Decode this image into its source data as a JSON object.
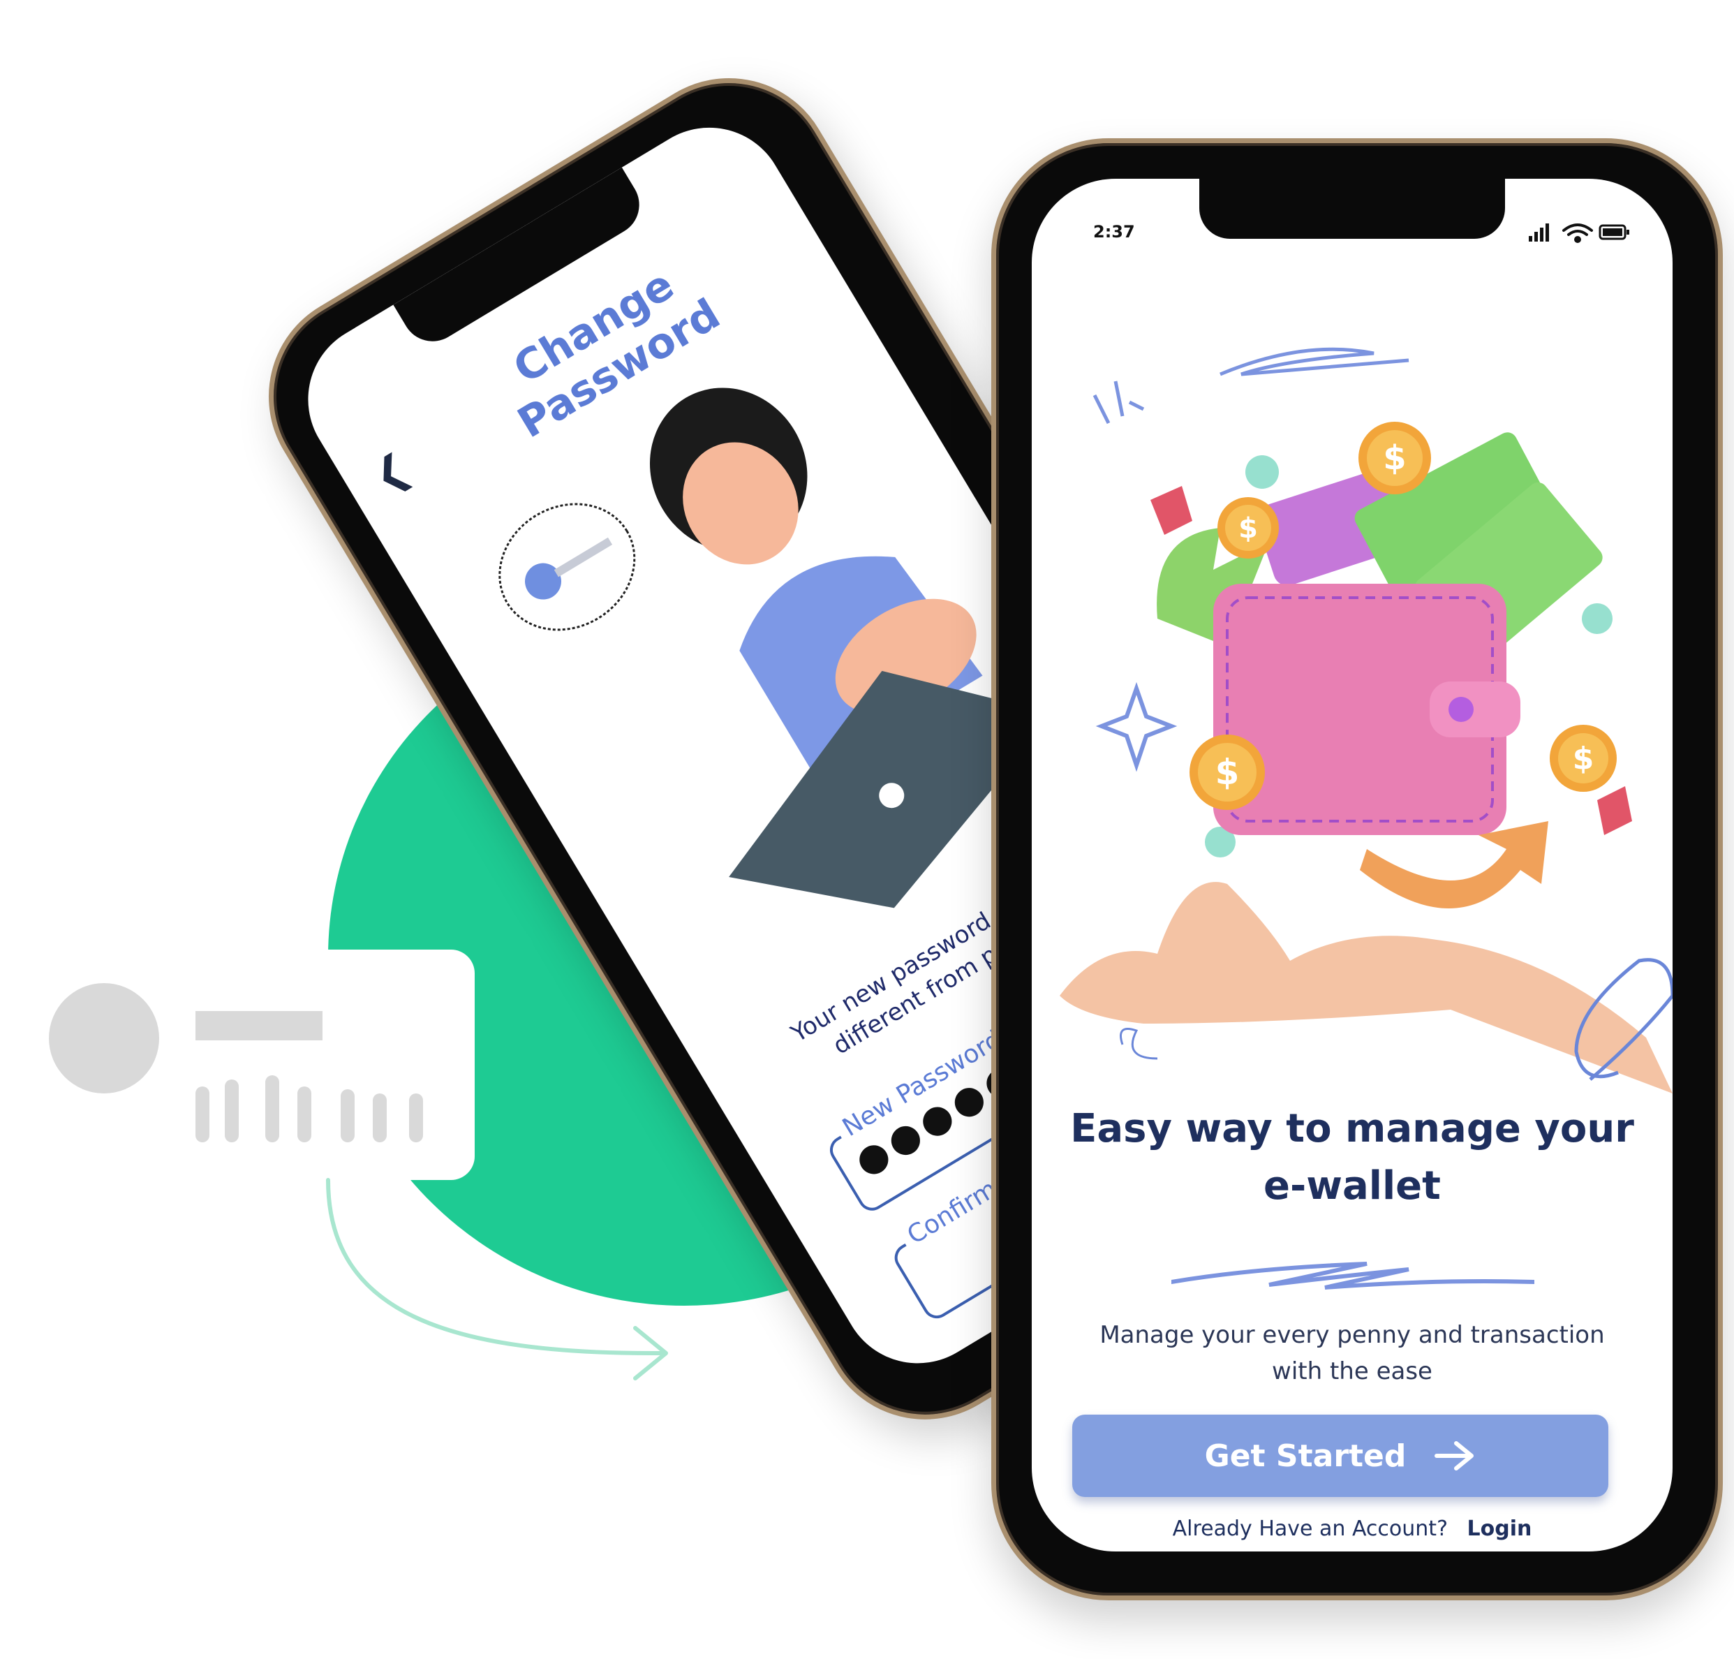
{
  "back_screen": {
    "title": "Change Password",
    "body_text": "Your new password must be different from previous",
    "fields": [
      {
        "label": "New Password",
        "value": "●●●●●●●●●"
      },
      {
        "label": "Confirm Password",
        "value": ""
      }
    ]
  },
  "front_screen": {
    "status_time": "2:37",
    "headline": "Easy way to manage your e-wallet",
    "subtitle": "Manage your every penny and transaction with the ease",
    "cta_label": "Get Started",
    "login_prompt": "Already Have an Account?",
    "login_link": "Login"
  },
  "colors": {
    "accent_blue": "#839fe0",
    "title_blue": "#5b7bd5",
    "navy": "#1e2f5e",
    "green": "#1ecb93",
    "phone_gold": "#a98f6e"
  },
  "icons": [
    "back-chevron-icon",
    "key-icon",
    "signal-icon",
    "wifi-icon",
    "battery-icon",
    "arrow-right-icon"
  ]
}
